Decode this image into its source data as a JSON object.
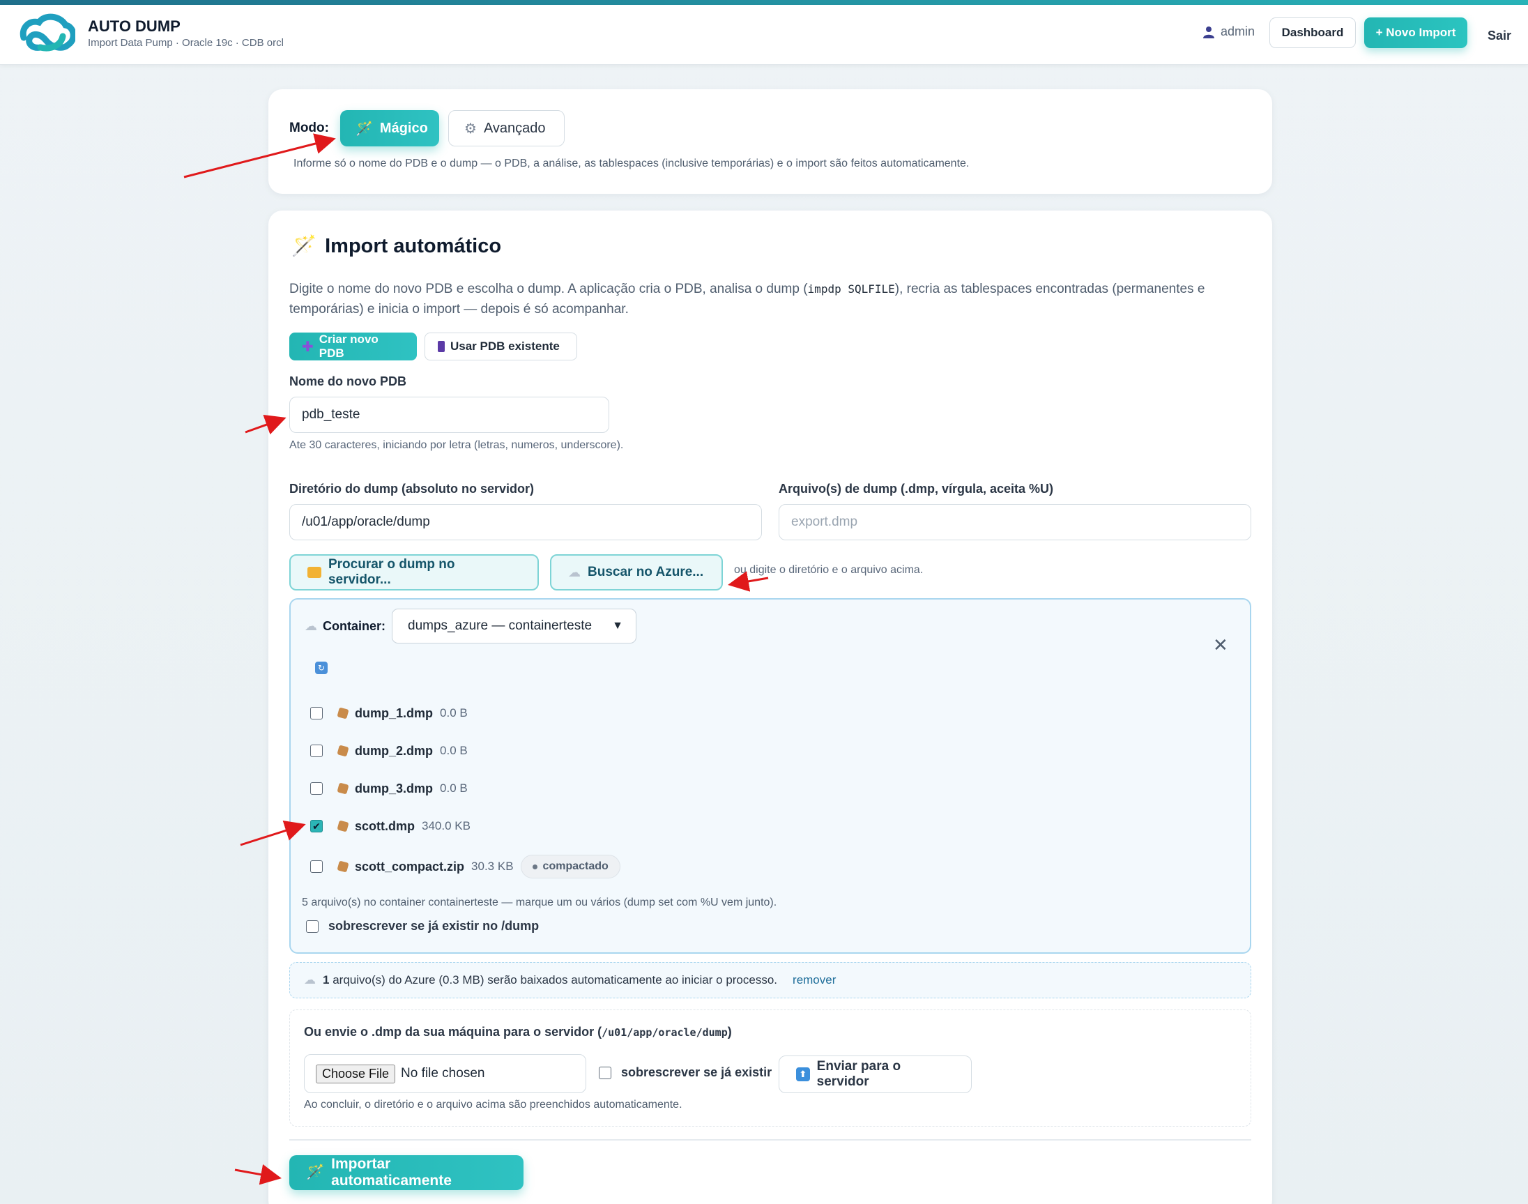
{
  "navbar": {
    "brand_title": "AUTO DUMP",
    "brand_subtitle": "Import Data Pump · Oracle 19c · CDB orcl",
    "user": "admin",
    "dashboard_label": "Dashboard",
    "novo_import_label": "+ Novo Import",
    "sair_label": "Sair"
  },
  "mode": {
    "label": "Modo:",
    "magico_label": "Mágico",
    "avancado_label": "Avançado",
    "selected": "Mágico",
    "description": "Informe só o nome do PDB e o dump — o PDB, a análise, as tablespaces (inclusive temporárias) e o import são feitos automaticamente."
  },
  "import_section": {
    "title": "Import automático",
    "desc_part1": "Digite o nome do novo PDB e escolha o dump. A aplicação cria o PDB, analisa o dump (",
    "desc_code": "impdp SQLFILE",
    "desc_part2": "), recria as tablespaces encontradas (permanentes e temporárias) e inicia o import — depois é só acompanhar.",
    "criar_label": "Criar novo PDB",
    "usar_label": "Usar PDB existente"
  },
  "pdb": {
    "label": "Nome do novo PDB",
    "value": "pdb_teste",
    "hint": "Ate 30 caracteres, iniciando por letra (letras, numeros, underscore)."
  },
  "dump": {
    "dir_label": "Diretório do dump (absoluto no servidor)",
    "dir_value": "/u01/app/oracle/dump",
    "file_label": "Arquivo(s) de dump (.dmp, vírgula, aceita %U)",
    "file_placeholder": "export.dmp",
    "browse_server_label": "Procurar o dump no servidor...",
    "browse_azure_label": "Buscar no Azure...",
    "browse_hint": "ou digite o diretório e o arquivo acima."
  },
  "azure": {
    "container_label": "Container:",
    "container_selected": "dumps_azure — containerteste",
    "files": [
      {
        "name": "dump_1.dmp",
        "size": "0.0 B",
        "checked": false,
        "badge": ""
      },
      {
        "name": "dump_2.dmp",
        "size": "0.0 B",
        "checked": false,
        "badge": ""
      },
      {
        "name": "dump_3.dmp",
        "size": "0.0 B",
        "checked": false,
        "badge": ""
      },
      {
        "name": "scott.dmp",
        "size": "340.0 KB",
        "checked": true,
        "badge": ""
      },
      {
        "name": "scott_compact.zip",
        "size": "30.3 KB",
        "checked": false,
        "badge": "compactado"
      }
    ],
    "note": "5 arquivo(s) no container containerteste — marque um ou vários (dump set com %U vem junto).",
    "overwrite_label": "sobrescrever se já existir no /dump"
  },
  "info": {
    "count": "1",
    "text": "arquivo(s) do Azure (0.3 MB) serão baixados automaticamente ao iniciar o processo.",
    "remove_label": "remover"
  },
  "upload": {
    "title_part": "Ou envie o .dmp da sua máquina para o servidor (",
    "title_code": "/u01/app/oracle/dump",
    "title_end": ")",
    "choose_label": "Choose File",
    "no_file": "No file chosen",
    "overwrite_label": "sobrescrever se já existir",
    "send_label": "Enviar para o servidor",
    "hint": "Ao concluir, o diretório e o arquivo acima são preenchidos automaticamente."
  },
  "submit": {
    "label": "Importar automaticamente"
  },
  "colors": {
    "accent": "#23b6b3",
    "annotation_arrow": "#e0191b"
  }
}
